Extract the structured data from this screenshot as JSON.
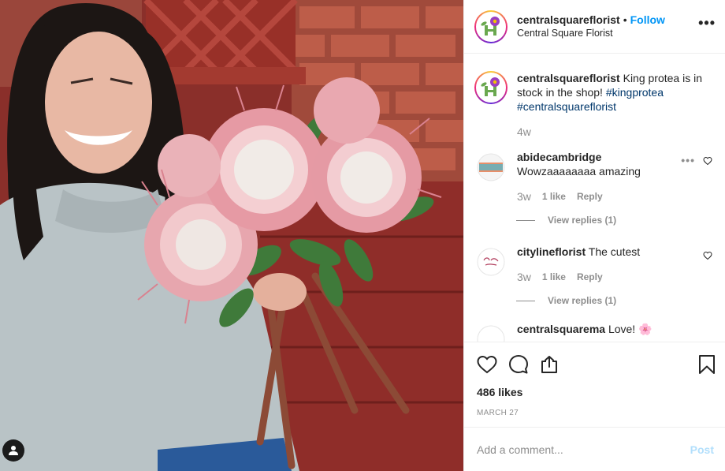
{
  "post": {
    "username": "centralsquareflorist",
    "display_name": "Central Square Florist",
    "follow_label": "Follow",
    "separator": "•",
    "more_label": "•••"
  },
  "caption": {
    "username": "centralsquareflorist",
    "text": "King protea is in stock in the shop!",
    "hashtags": [
      "#kingprotea",
      "#centralsquareflorist"
    ],
    "time": "4w"
  },
  "comments": [
    {
      "username": "abidecambridge",
      "text": "Wowzaaaaaaaa amazing",
      "time": "3w",
      "likes": "1 like",
      "reply_label": "Reply",
      "view_replies": "View replies (1)"
    },
    {
      "username": "citylineflorist",
      "text": "The cutest",
      "time": "3w",
      "likes": "1 like",
      "reply_label": "Reply",
      "view_replies": "View replies (1)"
    },
    {
      "username": "centralsquarema",
      "text": "Love! 🌸"
    }
  ],
  "stats": {
    "likes": "486 likes",
    "date": "MARCH 27"
  },
  "add_comment": {
    "placeholder": "Add a comment...",
    "post_label": "Post"
  },
  "icons": {
    "heart": "heart-icon",
    "comment": "comment-icon",
    "share": "share-icon",
    "save": "bookmark-icon",
    "more": "more-icon",
    "user_tag": "user-icon"
  },
  "colors": {
    "follow": "#0095f6",
    "hashtag": "#00376b",
    "muted": "#8e8e8e",
    "post_disabled": "#b2dffc"
  }
}
